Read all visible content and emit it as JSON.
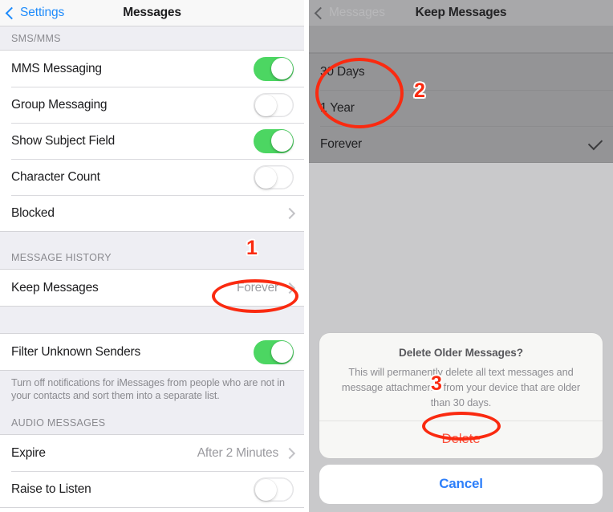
{
  "left_panel": {
    "navbar": {
      "back_label": "Settings",
      "title": "Messages"
    },
    "sections": [
      {
        "header": "SMS/MMS",
        "rows": [
          {
            "label": "MMS Messaging",
            "control": "toggle",
            "state": "on"
          },
          {
            "label": "Group Messaging",
            "control": "toggle",
            "state": "off"
          },
          {
            "label": "Show Subject Field",
            "control": "toggle",
            "state": "on"
          },
          {
            "label": "Character Count",
            "control": "toggle",
            "state": "off"
          },
          {
            "label": "Blocked",
            "control": "chevron",
            "value": ""
          }
        ]
      },
      {
        "header": "MESSAGE HISTORY",
        "rows": [
          {
            "label": "Keep Messages",
            "control": "chevron",
            "value": "Forever"
          }
        ]
      },
      {
        "header": "",
        "rows": [
          {
            "label": "Filter Unknown Senders",
            "control": "toggle",
            "state": "on"
          }
        ],
        "footer": "Turn off notifications for iMessages from people who are not in your contacts and sort them into a separate list."
      },
      {
        "header": "AUDIO MESSAGES",
        "rows": [
          {
            "label": "Expire",
            "control": "chevron",
            "value": "After 2 Minutes"
          },
          {
            "label": "Raise to Listen",
            "control": "toggle",
            "state": "off"
          }
        ]
      }
    ]
  },
  "right_panel": {
    "navbar": {
      "back_label": "Messages",
      "title": "Keep Messages"
    },
    "options": [
      {
        "label": "30 Days",
        "selected": false
      },
      {
        "label": "1 Year",
        "selected": false
      },
      {
        "label": "Forever",
        "selected": true
      }
    ],
    "alert": {
      "title": "Delete Older Messages?",
      "message": "This will permanently delete all text messages and message attachments from your device that are older than 30 days.",
      "destructive_label": "Delete",
      "cancel_label": "Cancel"
    }
  },
  "annotations": {
    "step1": "1",
    "step2": "2",
    "step3": "3"
  },
  "colors": {
    "accent_blue": "#2d7ffa",
    "toggle_green": "#4cd662",
    "destructive_red": "#fb503b",
    "annotation_red": "#fa2a10",
    "dim_overlay_gray": "#919193"
  }
}
